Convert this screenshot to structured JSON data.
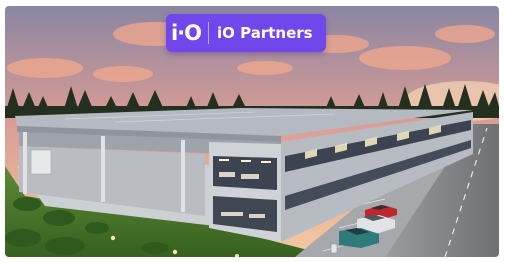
{
  "banner": {
    "logo_text": "i·O",
    "company_name": "iO Partners",
    "brand_color": "#7047eb"
  },
  "scene": {
    "icons": [
      "logo-mark-icon"
    ],
    "palette": {
      "sky_top": "#8a86a3",
      "sky_glow": "#f2b08a",
      "cloud": "#f3a98d",
      "roof": "#b4b9c2",
      "facade": "#cfd3d8",
      "glass": "#3b4450",
      "lawn": "#4c7a2c",
      "road": "#8e8f93"
    }
  }
}
